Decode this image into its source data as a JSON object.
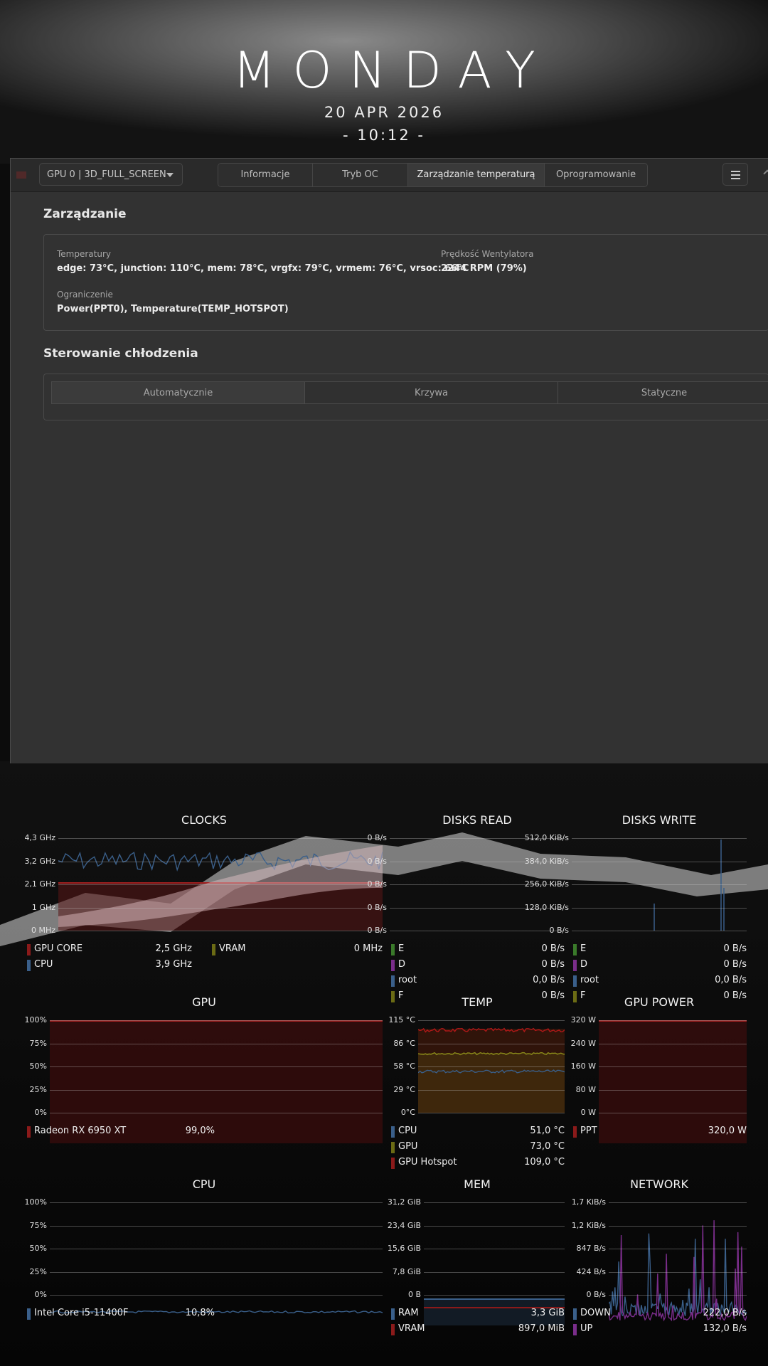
{
  "clock": {
    "day": "MONDAY",
    "date": "20 APR 2026",
    "time": "- 10:12 -"
  },
  "app": {
    "gpu_select": "GPU 0 | 3D_FULL_SCREEN",
    "tabs": [
      "Informacje",
      "Tryb OC",
      "Zarządzanie temperaturą",
      "Oprogramowanie"
    ],
    "active_tab": "Zarządzanie temperaturą",
    "management": {
      "title": "Zarządzanie",
      "temps_label": "Temperatury",
      "temps_value": "edge: 73°C, junction: 110°C, mem: 78°C, vrgfx: 79°C, vrmem: 76°C, vrsoc: 66°C",
      "fan_label": "Prędkość Wentylatora",
      "fan_value": "2244 RPM (79%)",
      "limit_label": "Ograniczenie",
      "limit_value": "Power(PPT0), Temperature(TEMP_HOTSPOT)"
    },
    "cooling": {
      "title": "Sterowanie chłodzenia",
      "modes": [
        "Automatycznie",
        "Krzywa",
        "Statyczne"
      ],
      "active_mode": "Automatycznie"
    }
  },
  "colors": {
    "red": "#8b1a1a",
    "blue": "#3a5f8a",
    "olive": "#6b6b14",
    "purple": "#7a2d8a",
    "green": "#3a7a2a"
  },
  "widgets": {
    "clocks": {
      "title": "CLOCKS",
      "axis": [
        "4,3 GHz",
        "3,2 GHz",
        "2,1 GHz",
        "1 GHz",
        "0 MHz"
      ],
      "legend": [
        {
          "name": "GPU CORE",
          "value": "2,5 GHz",
          "color": "#8b1a1a"
        },
        {
          "name": "VRAM",
          "value": "0 MHz",
          "color": "#6b6b14"
        },
        {
          "name": "CPU",
          "value": "3,9 GHz",
          "color": "#3a5f8a"
        }
      ]
    },
    "disks_read": {
      "title": "DISKS READ",
      "axis": [
        "0 B/s",
        "0 B/s",
        "0 B/s",
        "0 B/s",
        "0 B/s"
      ],
      "legend": [
        {
          "name": "E",
          "value": "0 B/s",
          "color": "#3a7a2a"
        },
        {
          "name": "D",
          "value": "0 B/s",
          "color": "#7a2d8a"
        },
        {
          "name": "root",
          "value": "0,0 B/s",
          "color": "#3a5f8a"
        },
        {
          "name": "F",
          "value": "0 B/s",
          "color": "#6b6b14"
        }
      ]
    },
    "disks_write": {
      "title": "DISKS WRITE",
      "axis": [
        "512,0 KiB/s",
        "384,0 KiB/s",
        "256,0 KiB/s",
        "128,0 KiB/s",
        "0 B/s"
      ],
      "legend": [
        {
          "name": "E",
          "value": "0 B/s",
          "color": "#3a7a2a"
        },
        {
          "name": "D",
          "value": "0 B/s",
          "color": "#7a2d8a"
        },
        {
          "name": "root",
          "value": "0,0 B/s",
          "color": "#3a5f8a"
        },
        {
          "name": "F",
          "value": "0 B/s",
          "color": "#6b6b14"
        }
      ]
    },
    "gpu": {
      "title": "GPU",
      "axis": [
        "100%",
        "75%",
        "50%",
        "25%",
        "0%"
      ],
      "legend": [
        {
          "name": "Radeon RX 6950 XT",
          "value": "99,0%",
          "color": "#8b1a1a"
        }
      ]
    },
    "temp": {
      "title": "TEMP",
      "axis": [
        "115 °C",
        "86 °C",
        "58 °C",
        "29 °C",
        "0°C"
      ],
      "legend": [
        {
          "name": "CPU",
          "value": "51,0 °C",
          "color": "#3a5f8a"
        },
        {
          "name": "GPU",
          "value": "73,0 °C",
          "color": "#6b6b14"
        },
        {
          "name": "GPU Hotspot",
          "value": "109,0 °C",
          "color": "#8b1a1a"
        }
      ]
    },
    "gpu_power": {
      "title": "GPU POWER",
      "axis": [
        "320 W",
        "240 W",
        "160 W",
        "80 W",
        "0 W"
      ],
      "legend": [
        {
          "name": "PPT",
          "value": "320,0 W",
          "color": "#8b1a1a"
        }
      ]
    },
    "cpu": {
      "title": "CPU",
      "axis": [
        "100%",
        "75%",
        "50%",
        "25%",
        "0%"
      ],
      "legend": [
        {
          "name": "Intel Core i5-11400F",
          "value": "10,8%",
          "color": "#3a5f8a"
        }
      ]
    },
    "mem": {
      "title": "MEM",
      "axis": [
        "31,2 GiB",
        "23,4 GiB",
        "15,6 GiB",
        "7,8 GiB",
        "0 B"
      ],
      "legend": [
        {
          "name": "RAM",
          "value": "3,3 GiB",
          "color": "#3a5f8a"
        },
        {
          "name": "VRAM",
          "value": "897,0 MiB",
          "color": "#8b1a1a"
        }
      ]
    },
    "network": {
      "title": "NETWORK",
      "axis": [
        "1,7 KiB/s",
        "1,2 KiB/s",
        "847 B/s",
        "424 B/s",
        "0 B/s"
      ],
      "legend": [
        {
          "name": "DOWN",
          "value": "222,0 B/s",
          "color": "#3a5f8a"
        },
        {
          "name": "UP",
          "value": "132,0 B/s",
          "color": "#7a2d8a"
        }
      ]
    }
  }
}
